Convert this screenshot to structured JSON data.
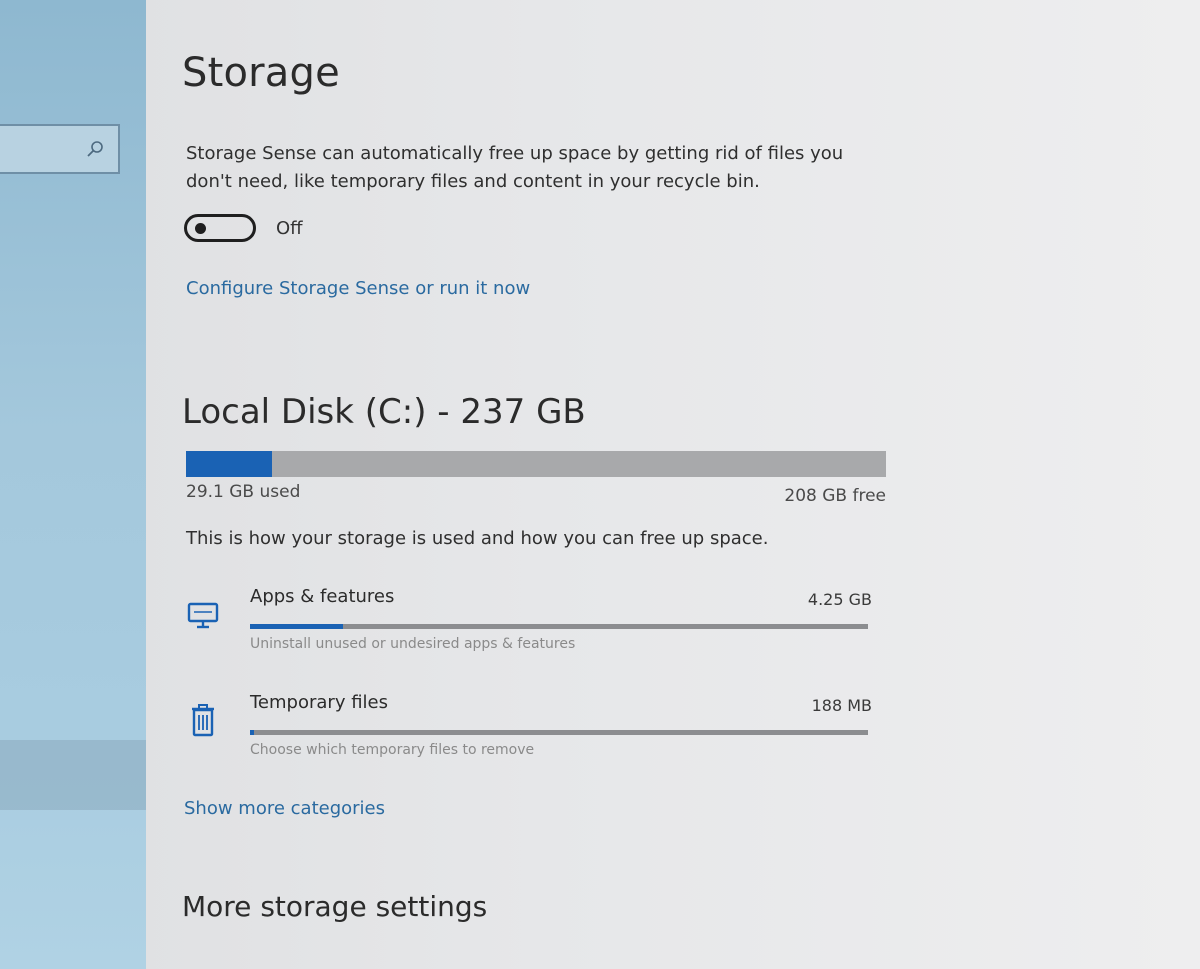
{
  "search": {
    "placeholder": ""
  },
  "storage": {
    "title": "Storage",
    "description": "Storage Sense can automatically free up space by getting rid of files you don't need, like temporary files and content in your recycle bin.",
    "toggle_state_label": "Off",
    "toggle_on": false,
    "configure_link": "Configure Storage Sense or run it now"
  },
  "disk": {
    "title": "Local Disk (C:) - 237 GB",
    "used_label": "29.1 GB used",
    "free_label": "208 GB free",
    "used_fraction": 0.123,
    "usage_description": "This is how your storage is used and how you can free up space."
  },
  "categories": [
    {
      "name": "Apps & features",
      "size": "4.25 GB",
      "hint": "Uninstall unused or undesired apps & features",
      "icon": "monitor-icon",
      "fill_fraction": 0.15
    },
    {
      "name": "Temporary files",
      "size": "188 MB",
      "hint": "Choose which temporary files to remove",
      "icon": "trash-icon",
      "fill_fraction": 0.007
    }
  ],
  "show_more_link": "Show more categories",
  "more_settings_title": "More storage settings",
  "colors": {
    "accent": "#1a62b4",
    "link": "#2a6aa0",
    "bar_track": "#a8a9ab",
    "sidebar": "#a4c8dc"
  }
}
